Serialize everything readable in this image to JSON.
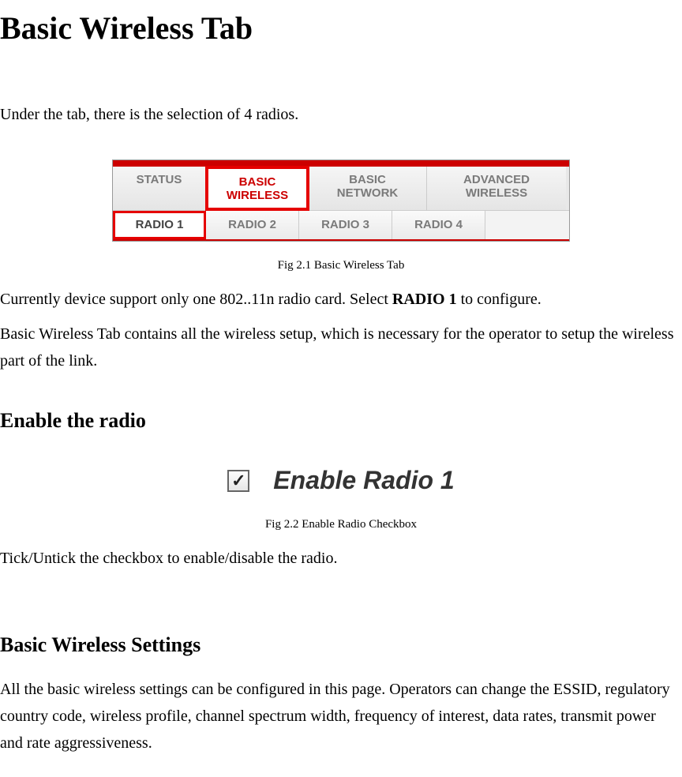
{
  "title": "Basic Wireless Tab",
  "intro": "Under the tab, there is the selection of 4 radios.",
  "fig1": {
    "tabs_row1": {
      "status": "STATUS",
      "basic_wireless_l1": "BASIC",
      "basic_wireless_l2": "WIRELESS",
      "basic_network_l1": "BASIC",
      "basic_network_l2": "NETWORK",
      "advanced_wireless_l1": "ADVANCED",
      "advanced_wireless_l2": "WIRELESS"
    },
    "tabs_row2": {
      "radio1": "RADIO 1",
      "radio2": "RADIO 2",
      "radio3": "RADIO 3",
      "radio4": "RADIO 4"
    },
    "caption": "Fig 2.1 Basic Wireless Tab"
  },
  "para1_pre": "Currently device support only one 802..11n radio card. Select ",
  "para1_bold": "RADIO 1",
  "para1_post": " to configure.",
  "para2": "Basic Wireless Tab contains all the wireless setup, which is necessary for the operator to setup the wireless part of the link.",
  "section_enable": {
    "heading": "Enable the radio",
    "checkbox_mark": "✓",
    "label": "Enable Radio 1",
    "caption": "Fig 2.2 Enable Radio Checkbox",
    "para": "Tick/Untick the checkbox to enable/disable the radio."
  },
  "section_settings": {
    "heading": "Basic Wireless Settings",
    "para": "All the basic wireless settings can be configured in this page. Operators can change the ESSID, regulatory country code, wireless profile, channel spectrum width, frequency of interest, data rates, transmit power and rate aggressiveness."
  }
}
